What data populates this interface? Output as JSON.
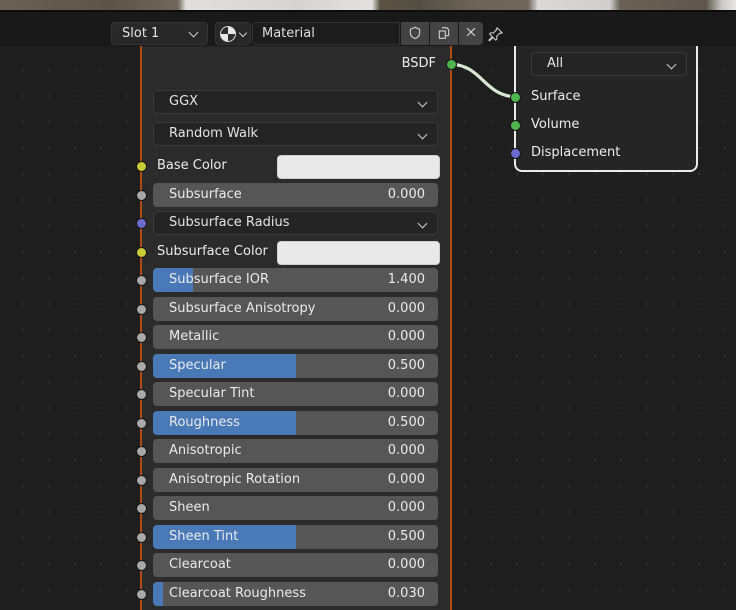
{
  "colors": {
    "accent_slider_fill": "#4a79b8",
    "selected_node_outline": "#b24c16",
    "active_node_outline": "#ebebeb",
    "noodle": "#d6e8d2",
    "socket_shader": "#4fb44f",
    "socket_color": "#cbcb35",
    "socket_vector": "#6b6bcf",
    "socket_float": "#a8a8a8",
    "swatch_white": "#e9e9e9"
  },
  "header": {
    "slot_selector": {
      "value": "Slot 1"
    },
    "material_selector_icon": "material-sphere-icon",
    "name_field": {
      "value": "Material"
    },
    "buttons": [
      {
        "name": "fake-user-button",
        "icon": "shield-icon"
      },
      {
        "name": "new-material-copy-button",
        "icon": "copy-icon"
      },
      {
        "name": "unlink-material-button",
        "icon": "x-icon"
      },
      {
        "name": "pin-button",
        "icon": "pin-icon"
      }
    ]
  },
  "nodes": {
    "principled_bsdf": {
      "selection": "selected",
      "outputs": [
        {
          "label": "BSDF",
          "socket": "shader",
          "connected": true
        }
      ],
      "rows": [
        {
          "type": "dropdown",
          "label": "GGX"
        },
        {
          "type": "dropdown",
          "label": "Random Walk"
        },
        {
          "type": "color",
          "label": "Base Color",
          "socket": "color",
          "swatch": "#e9e9e9"
        },
        {
          "type": "slider",
          "label": "Subsurface",
          "value": "0.000",
          "fill": 0,
          "socket": "float"
        },
        {
          "type": "dropdown",
          "label": "Subsurface Radius",
          "socket": "vector"
        },
        {
          "type": "color",
          "label": "Subsurface Color",
          "socket": "color",
          "swatch": "#e9e9e9"
        },
        {
          "type": "slider",
          "label": "Subsurface IOR",
          "value": "1.400",
          "fill": 0.14,
          "socket": "float"
        },
        {
          "type": "slider",
          "label": "Subsurface Anisotropy",
          "value": "0.000",
          "fill": 0,
          "socket": "float"
        },
        {
          "type": "slider",
          "label": "Metallic",
          "value": "0.000",
          "fill": 0,
          "socket": "float"
        },
        {
          "type": "slider",
          "label": "Specular",
          "value": "0.500",
          "fill": 0.5,
          "socket": "float"
        },
        {
          "type": "slider",
          "label": "Specular Tint",
          "value": "0.000",
          "fill": 0,
          "socket": "float"
        },
        {
          "type": "slider",
          "label": "Roughness",
          "value": "0.500",
          "fill": 0.5,
          "socket": "float"
        },
        {
          "type": "slider",
          "label": "Anisotropic",
          "value": "0.000",
          "fill": 0,
          "socket": "float"
        },
        {
          "type": "slider",
          "label": "Anisotropic Rotation",
          "value": "0.000",
          "fill": 0,
          "socket": "float"
        },
        {
          "type": "slider",
          "label": "Sheen",
          "value": "0.000",
          "fill": 0,
          "socket": "float"
        },
        {
          "type": "slider",
          "label": "Sheen Tint",
          "value": "0.500",
          "fill": 0.5,
          "socket": "float"
        },
        {
          "type": "slider",
          "label": "Clearcoat",
          "value": "0.000",
          "fill": 0,
          "socket": "float"
        },
        {
          "type": "slider",
          "label": "Clearcoat Roughness",
          "value": "0.030",
          "fill": 0.035,
          "socket": "float"
        }
      ]
    },
    "material_output": {
      "selection": "active",
      "dropdown": {
        "value": "All"
      },
      "inputs": [
        {
          "label": "Surface",
          "socket": "shader",
          "connected": true
        },
        {
          "label": "Volume",
          "socket": "shader",
          "connected": false
        },
        {
          "label": "Displacement",
          "socket": "vector",
          "connected": false
        }
      ]
    }
  },
  "link": {
    "from": "BSDF",
    "to": "Surface"
  }
}
